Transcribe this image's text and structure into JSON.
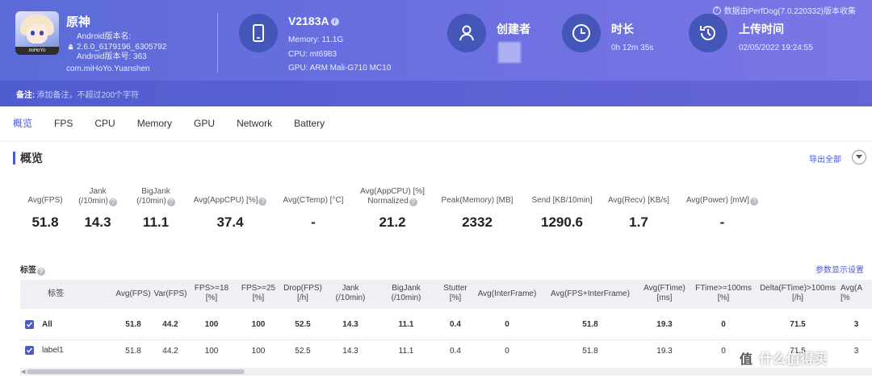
{
  "app": {
    "icon_tag": "miHoYo",
    "name": "原神",
    "android_version_name_label": "Android版本名:",
    "android_version_name": "2.6.0_6179196_6305792",
    "android_version_code": "Android版本号: 363",
    "package": "com.miHoYo.Yuanshen"
  },
  "device": {
    "icon": "phone-icon",
    "model": "V2183A",
    "info_icon": "i",
    "memory": "Memory: 11.1G",
    "cpu": "CPU: mt6983",
    "gpu": "GPU: ARM Mali-G710 MC10"
  },
  "creator": {
    "icon": "user-icon",
    "label": "创建者"
  },
  "duration": {
    "icon": "clock-icon",
    "label": "时长",
    "value": "0h 12m 35s"
  },
  "upload": {
    "icon": "history-icon",
    "label": "上传时间",
    "value": "02/05/2022 19:24:55"
  },
  "version_note": "数据由PerfDog(7.0.220332)版本收集",
  "remark": {
    "label": "备注:",
    "placeholder": "添加备注，不超过200个字符"
  },
  "tabs": [
    "概览",
    "FPS",
    "CPU",
    "Memory",
    "GPU",
    "Network",
    "Battery"
  ],
  "active_tab": "概览",
  "overview": {
    "title": "概览",
    "export_label": "导出全部",
    "metrics": [
      {
        "label": "Avg(FPS)",
        "value": "51.8"
      },
      {
        "label": "Jank\n(/10min)",
        "value": "14.3"
      },
      {
        "label": "BigJank\n(/10min)",
        "value": "11.1"
      },
      {
        "label": "Avg(AppCPU) [%]",
        "value": "37.4"
      },
      {
        "label": "Avg(CTemp) [°C]",
        "value": "-"
      },
      {
        "label": "Avg(AppCPU) [%]\nNormalized",
        "value": "21.2"
      },
      {
        "label": "Peak(Memory) [MB]",
        "value": "2332"
      },
      {
        "label": "Send [KB/10min]",
        "value": "1290.6"
      },
      {
        "label": "Avg(Recv) [KB/s]",
        "value": "1.7"
      },
      {
        "label": "Avg(Power) [mW]",
        "value": "-"
      }
    ]
  },
  "tags": {
    "title": "标签",
    "settings_link": "参数显示设置",
    "columns": [
      "标签",
      "Avg(FPS)",
      "Var(FPS)",
      "FPS>=18\n[%]",
      "FPS>=25\n[%]",
      "Drop(FPS)\n[/h]",
      "Jank\n(/10min)",
      "BigJank\n(/10min)",
      "Stutter\n[%]",
      "Avg(InterFrame)",
      "Avg(FPS+InterFrame)",
      "Avg(FTime)\n[ms]",
      "FTime>=100ms\n[%]",
      "Delta(FTime)>100ms\n[/h]",
      "Avg(A\n[%"
    ],
    "rows": [
      {
        "name": "All",
        "cells": [
          "51.8",
          "44.2",
          "100",
          "100",
          "52.5",
          "14.3",
          "11.1",
          "0.4",
          "0",
          "51.8",
          "19.3",
          "0",
          "71.5",
          "3"
        ]
      },
      {
        "name": "label1",
        "cells": [
          "51.8",
          "44.2",
          "100",
          "100",
          "52.5",
          "14.3",
          "11.1",
          "0.4",
          "0",
          "51.8",
          "19.3",
          "0",
          "71.5",
          "3"
        ]
      }
    ]
  },
  "watermark": {
    "badge": "值",
    "text": "什么值得买"
  }
}
